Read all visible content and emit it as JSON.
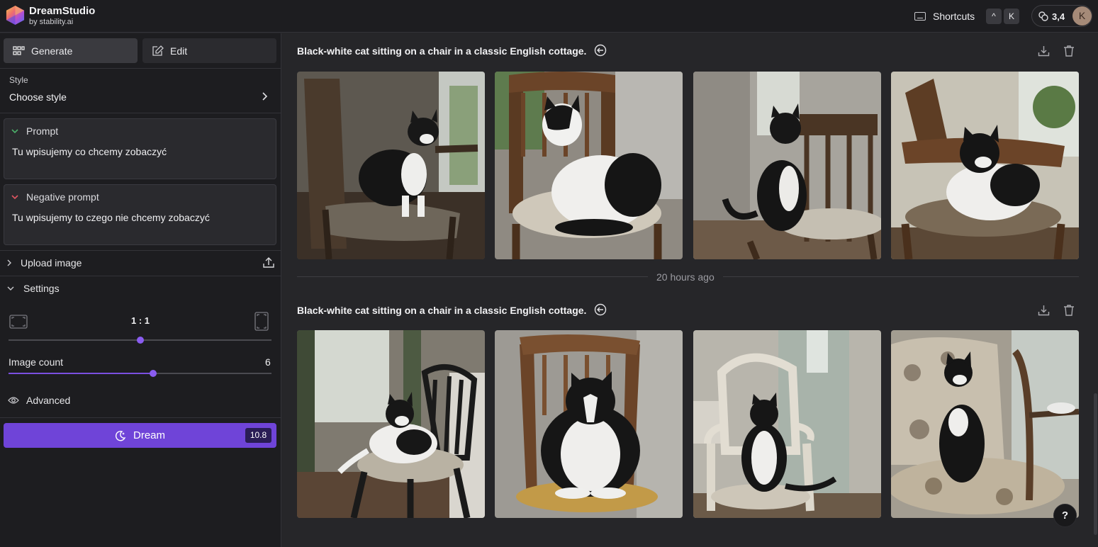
{
  "app": {
    "brand_name": "DreamStudio",
    "brand_sub": "by stability.ai",
    "logo_icon": "hexagon-gradient-logo"
  },
  "topbar": {
    "shortcuts_label": "Shortcuts",
    "shortcut_keys": [
      "^",
      "K"
    ],
    "credits": "3,4",
    "avatar_initial": "K"
  },
  "sidebar": {
    "tabs": [
      {
        "label": "Generate",
        "icon": "grid-icon",
        "active": true
      },
      {
        "label": "Edit",
        "icon": "edit-icon",
        "active": false
      }
    ],
    "style": {
      "label": "Style",
      "value": "Choose style"
    },
    "prompt": {
      "label": "Prompt",
      "text": "Tu wpisujemy co chcemy zobaczyć",
      "accent": "#4caf6a"
    },
    "negative_prompt": {
      "label": "Negative prompt",
      "text": "Tu wpisujemy to czego nie chcemy zobaczyć",
      "accent": "#e05561"
    },
    "upload_label": "Upload image",
    "settings_label": "Settings",
    "aspect_ratio": {
      "value": "1 : 1",
      "level": 0.5
    },
    "image_count": {
      "label": "Image count",
      "value": "6",
      "level": 0.55
    },
    "advanced_label": "Advanced",
    "dream": {
      "label": "Dream",
      "cost": "10.8",
      "color": "#6f44d8"
    }
  },
  "main": {
    "batches": [
      {
        "prompt": "Black-white cat sitting on a chair in a classic English cottage.",
        "image_count": 4
      },
      {
        "prompt": "Black-white cat sitting on a chair in a classic English cottage.",
        "image_count": 4
      }
    ],
    "separator_label": "20 hours ago"
  },
  "help_label": "?"
}
